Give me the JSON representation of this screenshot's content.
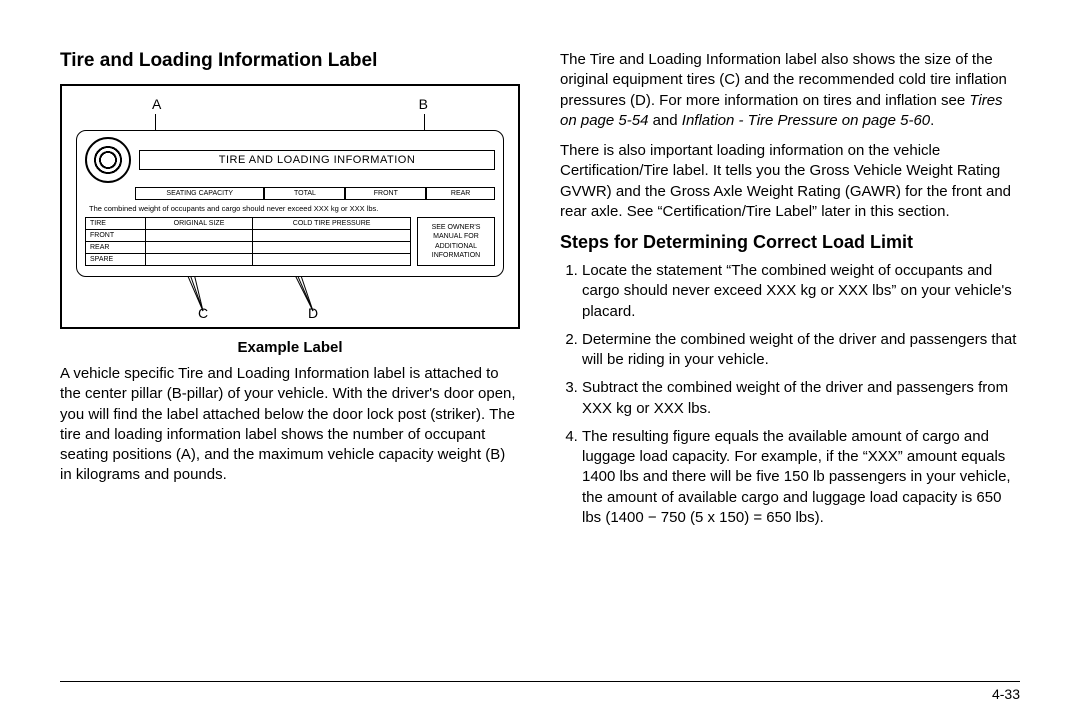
{
  "left": {
    "heading": "Tire and Loading Information Label",
    "diagram": {
      "letters": {
        "a": "A",
        "b": "B",
        "c": "C",
        "d": "D"
      },
      "bandTitle": "TIRE AND LOADING INFORMATION",
      "seating": {
        "label": "SEATING CAPACITY",
        "total": "TOTAL",
        "front": "FRONT",
        "rear": "REAR"
      },
      "combinedNote": "The combined weight of occupants and cargo should never exceed  XXX kg or XXX lbs.",
      "tableHeaders": {
        "tire": "TIRE",
        "size": "ORIGINAL SIZE",
        "pressure": "COLD TIRE PRESSURE"
      },
      "rows": [
        "FRONT",
        "REAR",
        "SPARE"
      ],
      "sidebox": [
        "SEE OWNER'S",
        "MANUAL FOR",
        "ADDITIONAL",
        "INFORMATION"
      ]
    },
    "caption": "Example Label",
    "para": "A vehicle specific Tire and Loading Information label is attached to the center pillar (B-pillar) of your vehicle. With the driver's door open, you will find the label attached below the door lock post (striker). The tire and loading information label shows the number of occupant seating positions (A), and the maximum vehicle capacity weight (B) in kilograms and pounds."
  },
  "right": {
    "para1a": "The Tire and Loading Information label also shows the size of the original equipment tires (C) and the recommended cold tire inflation pressures (D). For more information on tires and inflation see ",
    "para1b": "Tires on page 5-54",
    "para1c": " and ",
    "para1d": "Inflation - Tire Pressure on page 5-60",
    "para1e": ".",
    "para2": "There is also important loading information on the vehicle Certification/Tire label. It tells you the Gross Vehicle Weight Rating GVWR) and the Gross Axle Weight Rating (GAWR) for the front and rear axle. See “Certification/Tire Label” later in this section.",
    "heading": "Steps for Determining Correct Load Limit",
    "steps": [
      "Locate the statement “The combined weight of occupants and cargo should never exceed XXX kg or XXX lbs” on your vehicle's placard.",
      "Determine the combined weight of the driver and passengers that will be riding in your vehicle.",
      "Subtract the combined weight of the driver and passengers from XXX kg or XXX lbs.",
      "The resulting figure equals the available amount of cargo and luggage load capacity. For example, if the “XXX” amount equals 1400 lbs and there will be five 150 lb passengers in your vehicle, the amount of available cargo and luggage load capacity is 650 lbs (1400 − 750 (5 x 150) = 650 lbs)."
    ]
  },
  "pageNumber": "4-33"
}
